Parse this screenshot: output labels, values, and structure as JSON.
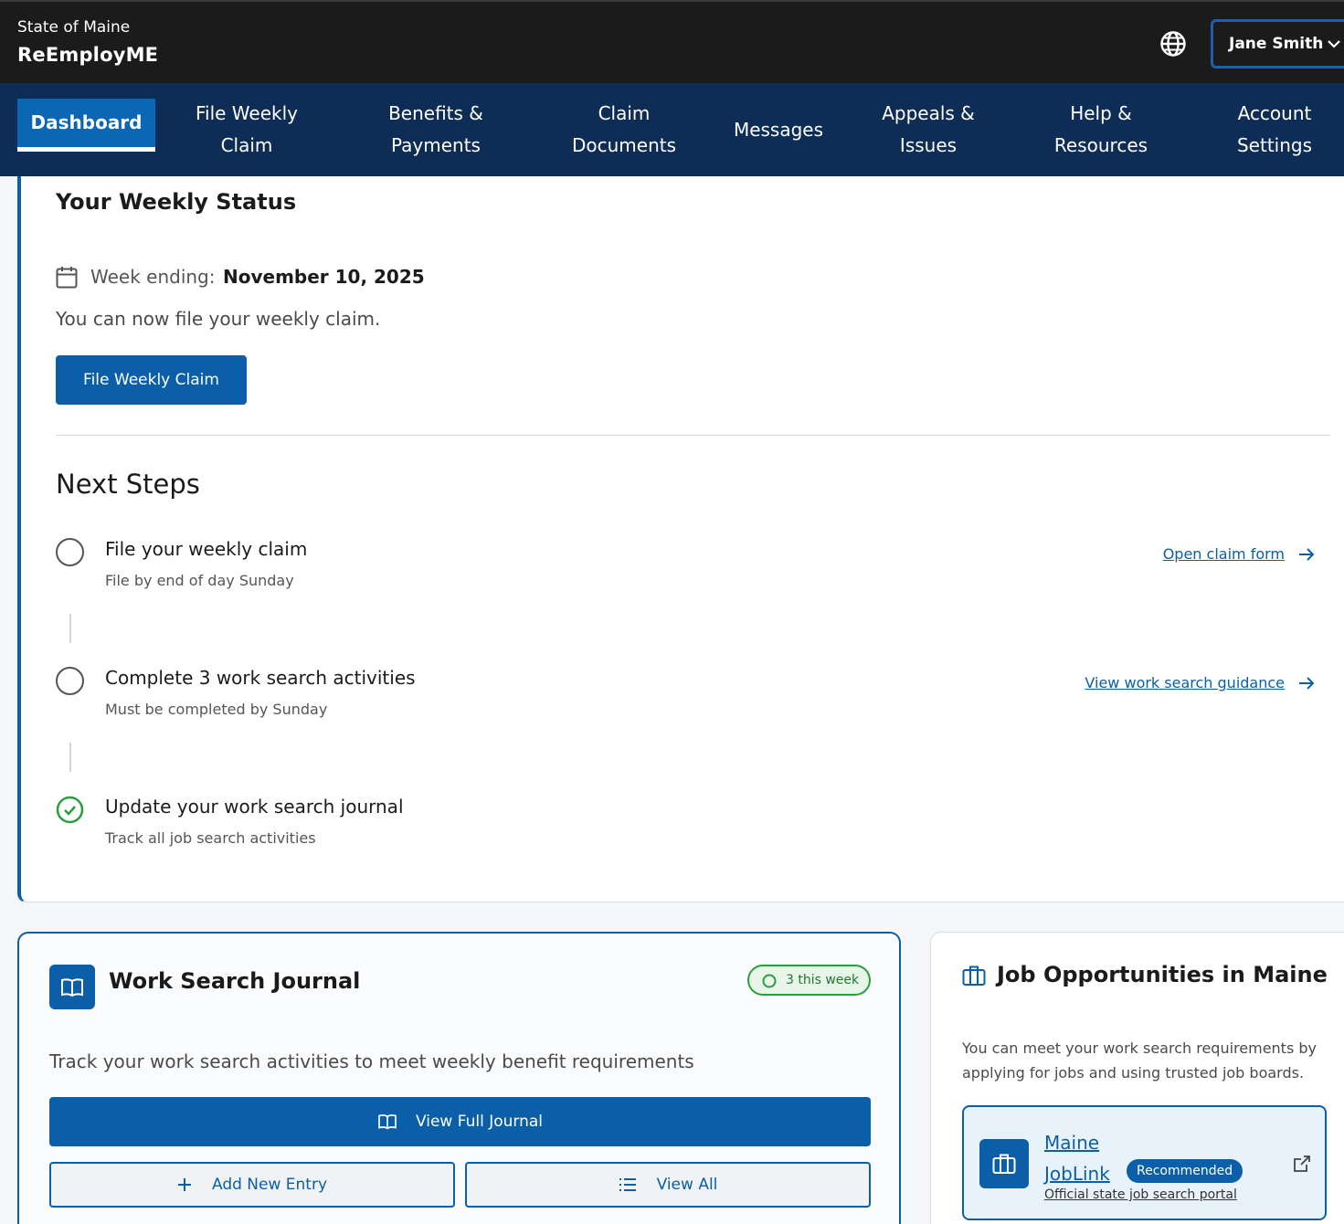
{
  "header": {
    "state": "State of Maine",
    "app_name": "ReEmployME",
    "user_name": "Jane Smith",
    "language_icon": "globe-icon"
  },
  "nav": {
    "items": [
      {
        "label": "Dashboard",
        "active": true
      },
      {
        "label": "File Weekly\nClaim"
      },
      {
        "label": "Benefits &\nPayments"
      },
      {
        "label": "Claim\nDocuments"
      },
      {
        "label": "Messages"
      },
      {
        "label": "Appeals &\nIssues"
      },
      {
        "label": "Help &\nResources"
      },
      {
        "label": "Account\nSettings"
      }
    ]
  },
  "weekly_status": {
    "title": "Your Weekly Status",
    "week_label": "Week ending:",
    "week_date": "November 10, 2025",
    "message": "You can now file your weekly claim.",
    "button_label": "File Weekly Claim"
  },
  "next_steps": {
    "title": "Next Steps",
    "steps": [
      {
        "title": "File your weekly claim",
        "subtitle": "File by end of day Sunday",
        "link": "Open claim form",
        "done": false
      },
      {
        "title": "Complete 3 work search activities",
        "subtitle": "Must be completed by Sunday",
        "link": "View work search guidance",
        "done": false
      },
      {
        "title": "Update your work search journal",
        "subtitle": "Track all job search activities",
        "done": true
      }
    ]
  },
  "journal": {
    "title": "Work Search Journal",
    "badge": "3 this week",
    "description": "Track your work search activities to meet weekly benefit requirements",
    "view_full": "View Full Journal",
    "add_entry": "Add New Entry",
    "view_all": "View All"
  },
  "jobs": {
    "title": "Job Opportunities in Maine",
    "description": "You can meet your work search requirements by applying for jobs and using trusted job boards.",
    "joblink": {
      "name": "Maine JobLink",
      "badge": "Recommended",
      "subtitle": "Official state job search portal"
    }
  },
  "colors": {
    "header_bg": "#1b1b1b",
    "nav_bg": "#0d2d57",
    "primary": "#0b5fa8",
    "success": "#2a9d3c"
  }
}
